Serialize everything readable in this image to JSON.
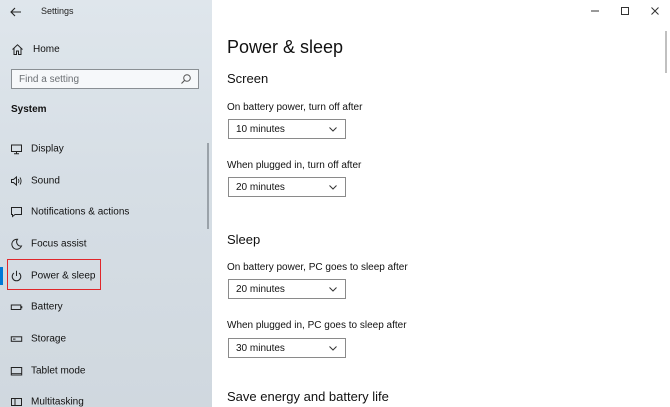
{
  "window": {
    "title": "Settings"
  },
  "sidebar": {
    "home_label": "Home",
    "search_placeholder": "Find a setting",
    "section": "System",
    "items": [
      {
        "label": "Display",
        "icon": "display-icon"
      },
      {
        "label": "Sound",
        "icon": "speaker-icon"
      },
      {
        "label": "Notifications & actions",
        "icon": "notifications-icon"
      },
      {
        "label": "Focus assist",
        "icon": "moon-icon"
      },
      {
        "label": "Power & sleep",
        "icon": "power-icon",
        "selected": true
      },
      {
        "label": "Battery",
        "icon": "battery-icon"
      },
      {
        "label": "Storage",
        "icon": "storage-icon"
      },
      {
        "label": "Tablet mode",
        "icon": "tablet-mode-icon"
      },
      {
        "label": "Multitasking",
        "icon": "multitasking-icon"
      }
    ]
  },
  "main": {
    "title": "Power & sleep",
    "screen": {
      "heading": "Screen",
      "battery_label": "On battery power, turn off after",
      "battery_value": "10 minutes",
      "plugged_label": "When plugged in, turn off after",
      "plugged_value": "20 minutes"
    },
    "sleep": {
      "heading": "Sleep",
      "battery_label": "On battery power, PC goes to sleep after",
      "battery_value": "20 minutes",
      "plugged_label": "When plugged in, PC goes to sleep after",
      "plugged_value": "30 minutes"
    },
    "save_energy_heading": "Save energy and battery life"
  },
  "colors": {
    "accent": "#0078d7",
    "highlight_box": "#e0262a",
    "sidebar_bg": "#d8dfe6"
  }
}
